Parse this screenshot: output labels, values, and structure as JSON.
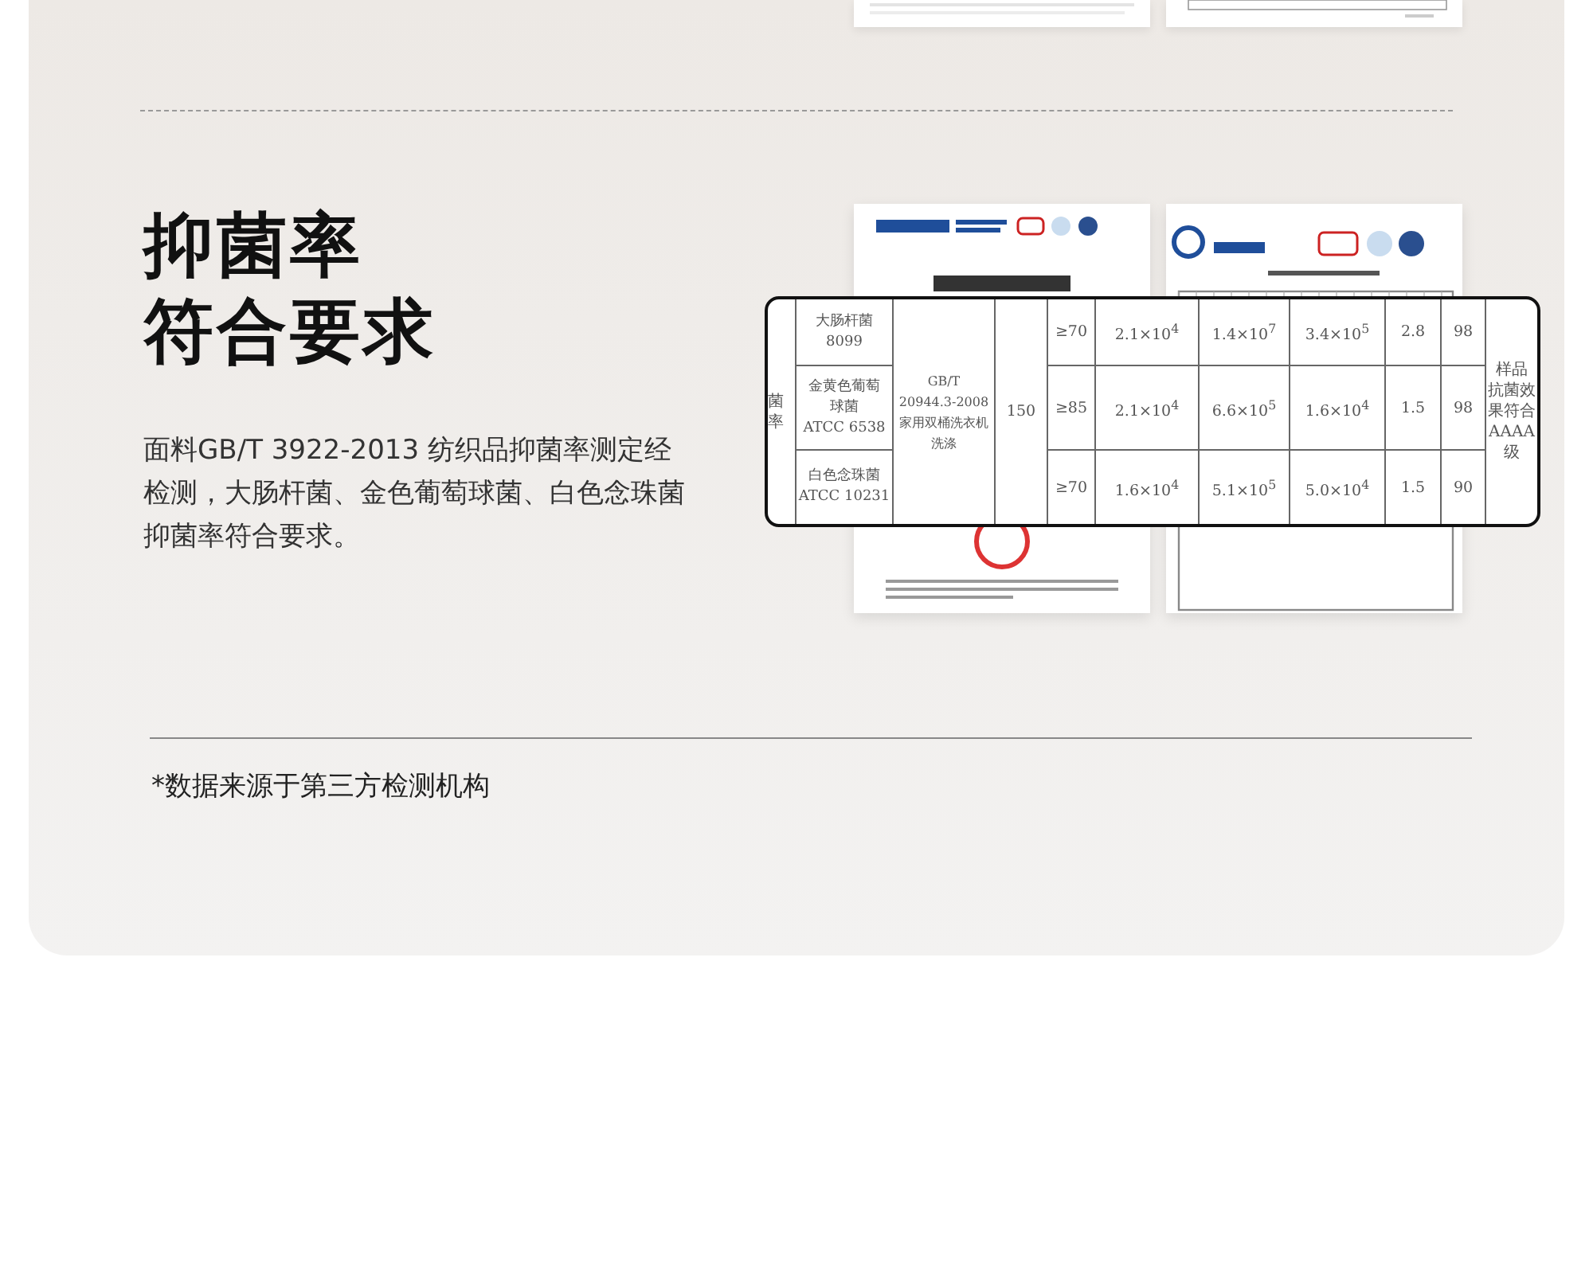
{
  "section": {
    "heading": [
      "抑菌率",
      "符合要求"
    ],
    "description": "面料GB/T 3922-2013 纺织品抑菌率测定经检测，大肠杆菌、金色葡萄球菌、白色念珠菌抑菌率符合要求。",
    "test_table": {
      "item": [
        "菌",
        "率"
      ],
      "method": [
        "GB/T",
        "20944.3-2008",
        "家用双桶洗衣机",
        "洗涤"
      ],
      "wash_count": "150",
      "rows": [
        {
          "strain": [
            "大肠杆菌",
            "8099"
          ],
          "cells": [
            "≥70",
            "2.1×10$^{4}$",
            "1.4×10$^{7}$",
            "3.4×10$^{5}$",
            "2.8",
            "98"
          ]
        },
        {
          "strain": [
            "金黄色葡萄",
            "球菌",
            "ATCC 6538"
          ],
          "cells": [
            "≥85",
            "2.1×10$^{4}$",
            "6.6×10$^{5}$",
            "1.6×10$^{4}$",
            "1.5",
            "98"
          ]
        },
        {
          "strain": [
            "白色念珠菌",
            "ATCC 10231"
          ],
          "cells": [
            "≥70",
            "1.6×10$^{4}$",
            "5.1×10$^{5}$",
            "5.0×10$^{4}$",
            "1.5",
            "90"
          ]
        }
      ],
      "result": [
        "样品",
        "抗菌效",
        "果符合",
        "AAAA",
        "级"
      ]
    }
  },
  "footnote": "*数据来源于第三方检测机构"
}
